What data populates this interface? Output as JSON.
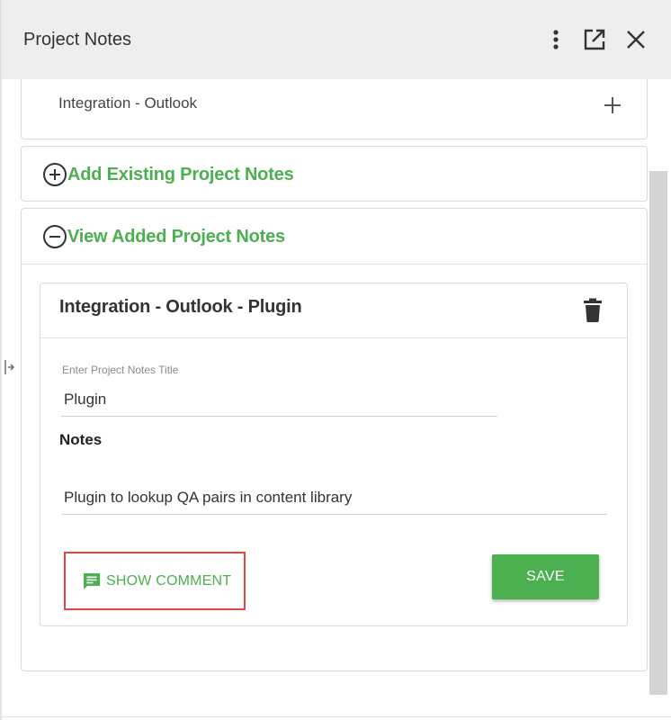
{
  "header": {
    "title": "Project Notes",
    "more_icon": "more-vertical-icon",
    "popout_icon": "open-external-icon",
    "close_icon": "close-icon"
  },
  "top_item": {
    "label": "Integration - Outlook",
    "icon": "plus-icon"
  },
  "add_section": {
    "label": "Add Existing Project Notes",
    "icon": "circle-plus-icon"
  },
  "view_section": {
    "label": "View Added Project Notes",
    "icon": "circle-minus-icon"
  },
  "note": {
    "title": "Integration - Outlook - Plugin",
    "delete_icon": "trash-icon",
    "title_field": {
      "placeholder": "Enter Project Notes Title",
      "value": "Plugin"
    },
    "notes_label": "Notes",
    "notes_field": {
      "value": "Plugin to lookup QA pairs in content library"
    },
    "show_comment_label": "SHOW COMMENT",
    "comment_icon": "comment-icon",
    "save_label": "SAVE"
  },
  "colors": {
    "accent_green": "#4caf50",
    "highlight_red": "#e04848",
    "header_bg": "#eeeeee"
  }
}
